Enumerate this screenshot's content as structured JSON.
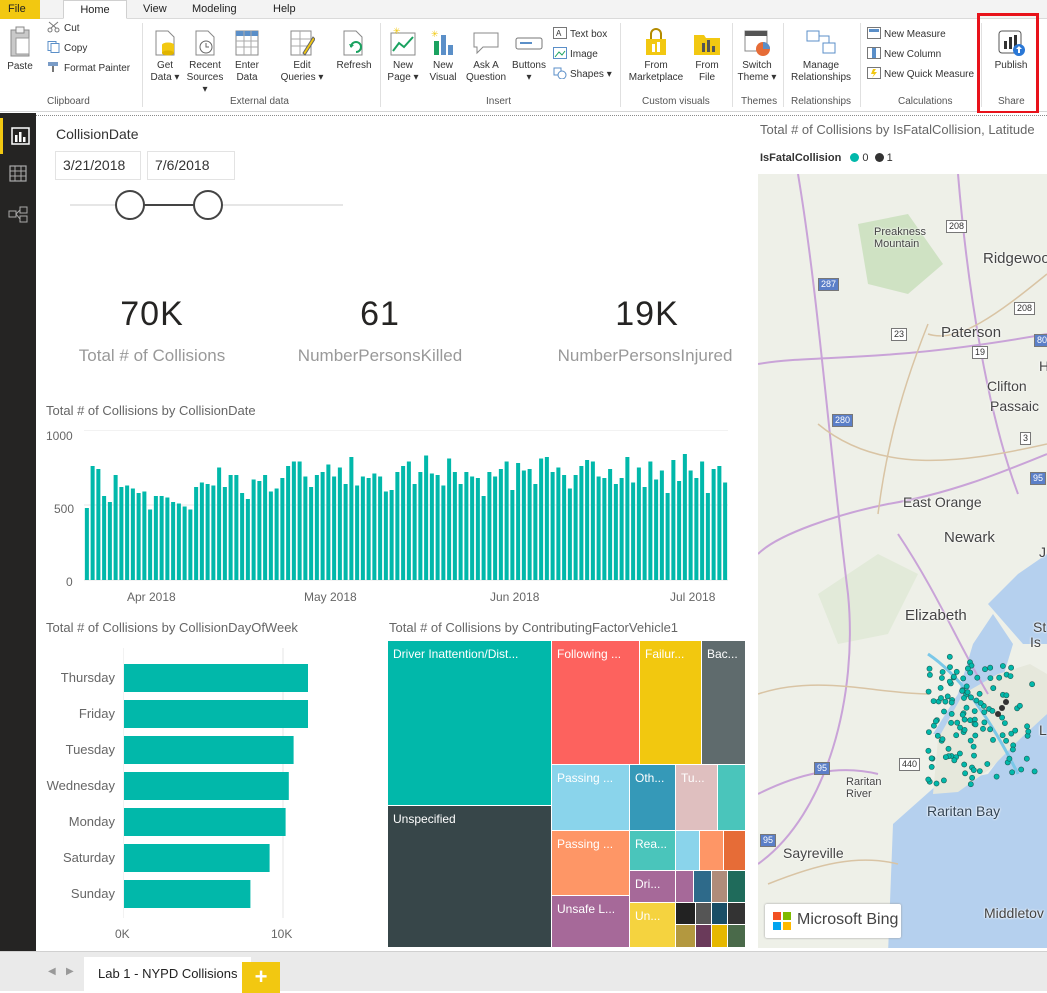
{
  "menu": {
    "tabs": [
      "File",
      "Home",
      "View",
      "Modeling",
      "Help"
    ],
    "active": "Home"
  },
  "ribbon": {
    "clipboard": {
      "paste": "Paste",
      "cut": "Cut",
      "copy": "Copy",
      "format_painter": "Format Painter",
      "group": "Clipboard"
    },
    "external_data": {
      "get_data": [
        "Get",
        "Data ▾"
      ],
      "recent_sources": [
        "Recent",
        "Sources ▾"
      ],
      "enter_data": [
        "Enter",
        "Data"
      ],
      "edit_queries": [
        "Edit",
        "Queries ▾"
      ],
      "refresh": "Refresh",
      "group": "External data"
    },
    "insert": {
      "new_page": [
        "New",
        "Page ▾"
      ],
      "new_visual": [
        "New",
        "Visual"
      ],
      "ask_question": [
        "Ask A",
        "Question"
      ],
      "buttons": [
        "Buttons",
        "▾"
      ],
      "text_box": "Text box",
      "image": "Image",
      "shapes": "Shapes ▾",
      "group": "Insert"
    },
    "custom_visuals": {
      "from_marketplace": [
        "From",
        "Marketplace"
      ],
      "from_file": [
        "From",
        "File"
      ],
      "group": "Custom visuals"
    },
    "themes": {
      "switch_theme": [
        "Switch",
        "Theme ▾"
      ],
      "group": "Themes"
    },
    "relationships": {
      "manage": [
        "Manage",
        "Relationships"
      ],
      "group": "Relationships"
    },
    "calculations": {
      "new_measure": "New Measure",
      "new_column": "New Column",
      "new_quick_measure": "New Quick Measure",
      "group": "Calculations"
    },
    "share": {
      "publish": "Publish",
      "group": "Share"
    }
  },
  "slicer": {
    "title": "CollisionDate",
    "start": "3/21/2018",
    "end": "7/6/2018"
  },
  "cards": [
    {
      "value": "70K",
      "label": "Total # of Collisions"
    },
    {
      "value": "61",
      "label": "NumberPersonsKilled"
    },
    {
      "value": "19K",
      "label": "NumberPersonsInjured"
    }
  ],
  "titles": {
    "date_chart": "Total # of Collisions by CollisionDate",
    "dow_chart": "Total # of Collisions by CollisionDayOfWeek",
    "factor_chart": "Total # of Collisions by ContributingFactorVehicle1",
    "map": "Total # of Collisions by IsFatalCollision, Latitude"
  },
  "map": {
    "legend_title": "IsFatalCollision",
    "legend": [
      {
        "label": "0",
        "color": "#01b8aa"
      },
      {
        "label": "1",
        "color": "#333333"
      }
    ],
    "places": [
      "Preakness Mountain",
      "Ridgewoo",
      "Paterson",
      "Clifton",
      "Passaic",
      "East Orange",
      "Newark",
      "Elizabeth",
      "Raritan River",
      "Raritan Bay",
      "Sayreville",
      "Middletov",
      "St",
      "Is",
      "J",
      "H",
      "L"
    ],
    "shields": [
      "208",
      "287",
      "208",
      "23",
      "19",
      "80",
      "280",
      "3",
      "95",
      "95",
      "440",
      "95"
    ],
    "attribution": "Microsoft Bing"
  },
  "chart_data": [
    {
      "type": "bar",
      "title": "Total # of Collisions by CollisionDate",
      "x_ticks": [
        "Apr 2018",
        "May 2018",
        "Jun 2018",
        "Jul 2018"
      ],
      "y_ticks": [
        "1000",
        "500",
        "0"
      ],
      "ylim": [
        0,
        1000
      ],
      "x_range": [
        "2018-03-21",
        "2018-07-06"
      ],
      "color": "#01b8aa",
      "values": [
        480,
        760,
        740,
        560,
        520,
        700,
        620,
        630,
        610,
        580,
        590,
        470,
        560,
        560,
        550,
        520,
        510,
        490,
        470,
        620,
        650,
        640,
        630,
        750,
        620,
        700,
        700,
        580,
        540,
        670,
        660,
        700,
        590,
        610,
        680,
        760,
        790,
        790,
        690,
        620,
        700,
        720,
        770,
        690,
        750,
        640,
        820,
        630,
        690,
        680,
        710,
        690,
        590,
        600,
        720,
        760,
        790,
        640,
        720,
        830,
        710,
        700,
        630,
        810,
        720,
        640,
        720,
        690,
        680,
        560,
        720,
        690,
        740,
        790,
        600,
        780,
        730,
        740,
        640,
        810,
        820,
        720,
        750,
        700,
        610,
        700,
        760,
        800,
        790,
        690,
        680,
        740,
        640,
        680,
        820,
        650,
        750,
        620,
        790,
        670,
        730,
        580,
        800,
        660,
        840,
        730,
        680,
        790,
        580,
        740,
        760,
        650
      ]
    },
    {
      "type": "bar",
      "orientation": "horizontal",
      "title": "Total # of Collisions by CollisionDayOfWeek",
      "categories": [
        "Thursday",
        "Friday",
        "Tuesday",
        "Wednesday",
        "Monday",
        "Saturday",
        "Sunday"
      ],
      "values": [
        11500,
        11500,
        10600,
        10300,
        10100,
        9100,
        7900
      ],
      "x_ticks": [
        "0K",
        "10K"
      ],
      "xlim": [
        0,
        12500
      ],
      "color": "#01b8aa"
    },
    {
      "type": "treemap",
      "title": "Total # of Collisions by ContributingFactorVehicle1",
      "labels": [
        "Driver Inattention/Dist...",
        "Unspecified",
        "Following ...",
        "Failur...",
        "Bac...",
        "Passing ...",
        "Oth...",
        "Tu...",
        "Passing ...",
        "Rea...",
        "Dri...",
        "Unsafe L...",
        "Un..."
      ],
      "colors": [
        "#01b8aa",
        "#374649",
        "#fd625e",
        "#f2c80f",
        "#5f6b6d",
        "#8ad4eb",
        "#3599b8",
        "#dfbfbf",
        "#fe9666",
        "#4ac5bb",
        "#a66999",
        "#a66999",
        "#f5d33f"
      ]
    }
  ],
  "tabs": {
    "page": "Lab 1 - NYPD Collisions",
    "add": "+"
  }
}
